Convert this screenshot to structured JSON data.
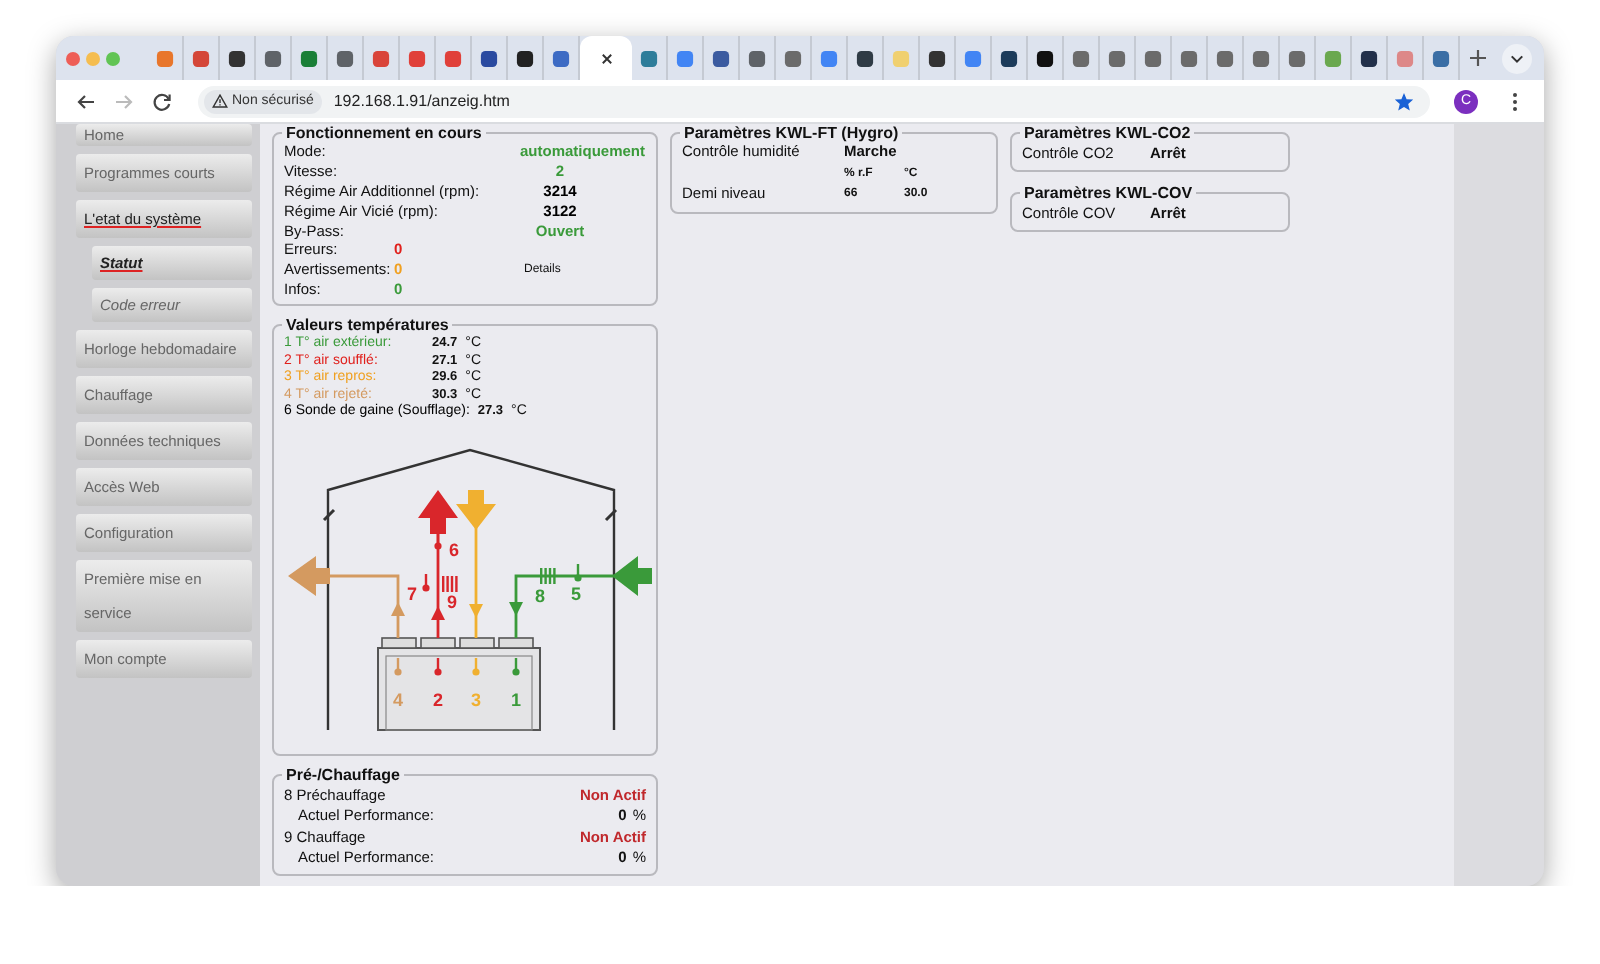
{
  "browser": {
    "tabs": [
      {
        "selected": false,
        "color": "#e8762b"
      },
      {
        "selected": false,
        "color": "#d44638"
      },
      {
        "selected": false,
        "color": "#333333"
      },
      {
        "selected": false,
        "color": "#5f6368"
      },
      {
        "selected": false,
        "color": "#1a7f37"
      },
      {
        "selected": false,
        "color": "#5f6368"
      },
      {
        "selected": false,
        "color": "#d9443a"
      },
      {
        "selected": false,
        "color": "#e0403a"
      },
      {
        "selected": false,
        "color": "#e0403a"
      },
      {
        "selected": false,
        "color": "#2a4aa0"
      },
      {
        "selected": false,
        "color": "#222222"
      },
      {
        "selected": false,
        "color": "#3d6bc4"
      },
      {
        "selected": true
      },
      {
        "selected": false,
        "color": "#2e7d9a"
      },
      {
        "selected": false,
        "color": "#4285f4"
      },
      {
        "selected": false,
        "color": "#3b5ba0"
      },
      {
        "selected": false,
        "color": "#5f6368"
      },
      {
        "selected": false,
        "color": "#6b6b6b"
      },
      {
        "selected": false,
        "color": "#4285f4"
      },
      {
        "selected": false,
        "color": "#2f3b45"
      },
      {
        "selected": false,
        "color": "#f0d070"
      },
      {
        "selected": false,
        "color": "#333333"
      },
      {
        "selected": false,
        "color": "#4285f4"
      },
      {
        "selected": false,
        "color": "#1c3b5a"
      },
      {
        "selected": false,
        "color": "#111111"
      },
      {
        "selected": false,
        "color": "#6b6b6b"
      },
      {
        "selected": false,
        "color": "#6b6b6b"
      },
      {
        "selected": false,
        "color": "#6b6b6b"
      },
      {
        "selected": false,
        "color": "#6b6b6b"
      },
      {
        "selected": false,
        "color": "#6b6b6b"
      },
      {
        "selected": false,
        "color": "#6b6b6b"
      },
      {
        "selected": false,
        "color": "#6b6b6b"
      },
      {
        "selected": false,
        "color": "#6aa84f"
      },
      {
        "selected": false,
        "color": "#22304a"
      },
      {
        "selected": false,
        "color": "#dd8888"
      },
      {
        "selected": false,
        "color": "#3a6ea5"
      }
    ],
    "address": {
      "security_label": "Non sécurisé",
      "url": "192.168.1.91/anzeig.htm"
    },
    "profile_initial": "C"
  },
  "sidebar": {
    "items": [
      {
        "label": "Home",
        "selected": false
      },
      {
        "label": "Programmes courts",
        "selected": false
      },
      {
        "label": "L'etat du système",
        "selected": true,
        "children": [
          {
            "label": "Statut",
            "selected": true
          },
          {
            "label": "Code erreur",
            "selected": false
          }
        ]
      },
      {
        "label": "Horloge hebdomadaire",
        "selected": false
      },
      {
        "label": "Chauffage",
        "selected": false
      },
      {
        "label": "Données techniques",
        "selected": false
      },
      {
        "label": "Accès Web",
        "selected": false
      },
      {
        "label": "Configuration",
        "selected": false
      },
      {
        "label": "Première mise en service",
        "selected": false
      },
      {
        "label": "Mon compte",
        "selected": false
      }
    ]
  },
  "operation": {
    "title": "Fonctionnement en cours",
    "rows": [
      {
        "kind": "status",
        "label": "Mode:",
        "value": "automatiquement",
        "color": "#3a9a3a"
      },
      {
        "kind": "status",
        "label": "Vitesse:",
        "value": "2",
        "color": "#3a9a3a"
      },
      {
        "kind": "status",
        "label": "Régime Air Additionnel (rpm):",
        "value": "3214",
        "color": "#000000"
      },
      {
        "kind": "status",
        "label": "Régime Air Vicié (rpm):",
        "value": "3122",
        "color": "#000000"
      },
      {
        "kind": "status",
        "label": "By-Pass:",
        "value": "Ouvert",
        "color": "#3a9a3a"
      },
      {
        "kind": "count",
        "label": "Erreurs:",
        "value": "0",
        "color": "#e0201c"
      },
      {
        "kind": "count",
        "label": "Avertissements:",
        "value": "0",
        "color": "#f0a020",
        "link": "Details"
      },
      {
        "kind": "count",
        "label": "Infos:",
        "value": "0",
        "color": "#3a9a3a"
      }
    ]
  },
  "temperatures": {
    "title": "Valeurs températures",
    "rows": [
      {
        "label": "1 T° air extérieur:",
        "value": "24.7",
        "unit": "°C",
        "color": "#3a9a3a"
      },
      {
        "label": "2 T° air soufflé:",
        "value": "27.1",
        "unit": "°C",
        "color": "#e0201c"
      },
      {
        "label": "3 T° air repros:",
        "value": "29.6",
        "unit": "°C",
        "color": "#f0a020"
      },
      {
        "label": "4 T° air rejeté:",
        "value": "30.3",
        "unit": "°C",
        "color": "#d49a60"
      },
      {
        "label": "6 Sonde de gaine (Soufflage):",
        "value": "27.3",
        "unit": "°C",
        "color": "#000000"
      }
    ],
    "diagram": {
      "sensor_numbers": [
        {
          "number": "6",
          "color": "#d9262b"
        },
        {
          "number": "7",
          "color": "#d9262b"
        },
        {
          "number": "9",
          "color": "#d9262b"
        },
        {
          "number": "8",
          "color": "#3a9a3a"
        },
        {
          "number": "5",
          "color": "#3a9a3a"
        },
        {
          "number": "4",
          "color": "#d49a60"
        },
        {
          "number": "2",
          "color": "#d9262b"
        },
        {
          "number": "3",
          "color": "#f0b030"
        },
        {
          "number": "1",
          "color": "#3a9a3a"
        }
      ]
    }
  },
  "heating": {
    "title": "Pré-/Chauffage",
    "rows": [
      {
        "kind": "state",
        "label": "8 Préchauffage",
        "value": "Non Actif"
      },
      {
        "kind": "performance",
        "label": "Actuel Performance:",
        "value": "0",
        "unit": "%"
      },
      {
        "kind": "state",
        "label": "9 Chauffage",
        "value": "Non Actif"
      },
      {
        "kind": "performance",
        "label": "Actuel Performance:",
        "value": "0",
        "unit": "%"
      }
    ]
  },
  "hygro": {
    "title": "Paramètres KWL-FT (Hygro)",
    "control_label": "Contrôle humidité",
    "control_value": "Marche",
    "columns": [
      "% r.F",
      "°C"
    ],
    "level_label": "Demi niveau",
    "level_values": [
      "66",
      "30.0"
    ]
  },
  "co2": {
    "title": "Paramètres KWL-CO2",
    "label": "Contrôle CO2",
    "value": "Arrêt"
  },
  "cov": {
    "title": "Paramètres KWL-COV",
    "label": "Contrôle COV",
    "value": "Arrêt"
  }
}
